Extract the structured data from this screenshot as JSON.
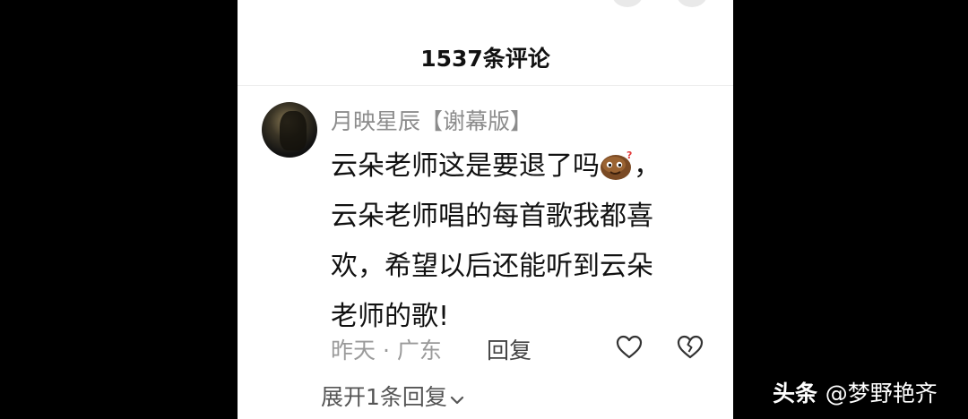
{
  "header": {
    "comment_count": "1537条评论"
  },
  "comment": {
    "username": "月映星辰【谢幕版】",
    "lines": [
      "云朵老师这是要退了吗",
      "云朵老师唱的每首歌我都喜",
      "欢，希望以后还能听到云朵",
      "老师的歌!"
    ],
    "line1_suffix": "，",
    "emoji": "thinking-potato-sticker",
    "time_location": "昨天 · 广东",
    "reply_label": "回复"
  },
  "replies": {
    "expand_label": "展开1条回复"
  },
  "watermark": {
    "brand": "头条",
    "account": "@梦野艳齐"
  },
  "colors": {
    "background": "#000000",
    "panel": "#ffffff",
    "meta_text": "#9a9a9a",
    "username": "#8c8c8c"
  }
}
